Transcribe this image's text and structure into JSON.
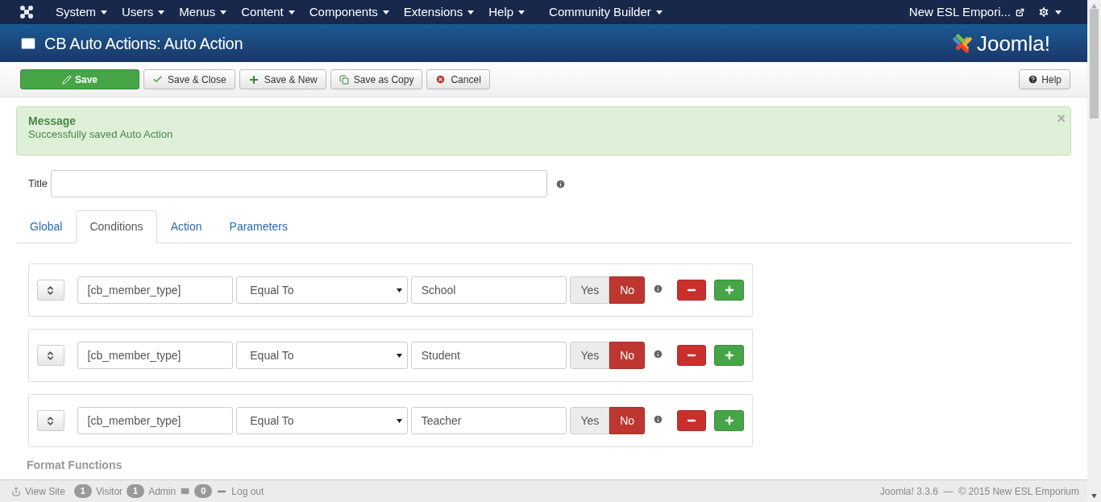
{
  "navbar": {
    "menus": [
      {
        "label": "System"
      },
      {
        "label": "Users"
      },
      {
        "label": "Menus"
      },
      {
        "label": "Content"
      },
      {
        "label": "Components"
      },
      {
        "label": "Extensions"
      },
      {
        "label": "Help"
      },
      {
        "label": "Community Builder"
      }
    ],
    "site_link": "New ESL Empori..."
  },
  "header": {
    "title": "CB Auto Actions: Auto Action",
    "logo_text": "Joomla!"
  },
  "toolbar": {
    "buttons": [
      {
        "label": "Save",
        "kind": "save"
      },
      {
        "label": "Save & Close",
        "kind": "check"
      },
      {
        "label": "Save & New",
        "kind": "plus"
      },
      {
        "label": "Save as Copy",
        "kind": "copy"
      },
      {
        "label": "Cancel",
        "kind": "cancel"
      }
    ],
    "help": "Help"
  },
  "message": {
    "heading": "Message",
    "text": "Successfully saved Auto Action",
    "close": "×"
  },
  "title_field": {
    "label": "Title"
  },
  "tabs": [
    {
      "label": "Global",
      "selected": false
    },
    {
      "label": "Conditions",
      "selected": true
    },
    {
      "label": "Action",
      "selected": false
    },
    {
      "label": "Parameters",
      "selected": false
    }
  ],
  "conditions": [
    {
      "field": "[cb_member_type]",
      "operator": "Equal To",
      "value": "School",
      "toggle": [
        {
          "label": "Yes",
          "selected": false
        },
        {
          "label": "No",
          "selected": true
        }
      ]
    },
    {
      "field": "[cb_member_type]",
      "operator": "Equal To",
      "value": "Student",
      "toggle": [
        {
          "label": "Yes",
          "selected": false
        },
        {
          "label": "No",
          "selected": true
        }
      ]
    },
    {
      "field": "[cb_member_type]",
      "operator": "Equal To",
      "value": "Teacher",
      "toggle": [
        {
          "label": "Yes",
          "selected": false
        },
        {
          "label": "No",
          "selected": true
        }
      ]
    }
  ],
  "next_section": "Format Functions",
  "status_bar": {
    "view_site": "View Site",
    "visitors": {
      "count": "1",
      "label": "Visitor"
    },
    "admins": {
      "count": "1",
      "label": "Admin"
    },
    "messages": {
      "count": "0"
    },
    "logout": "Log out",
    "footer": "Joomla! 3.3.6  —  © 2015 New ESL Emporium"
  }
}
